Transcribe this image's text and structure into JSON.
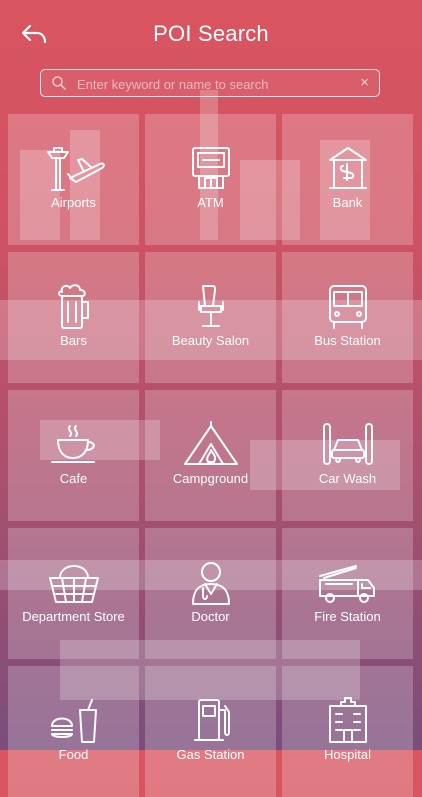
{
  "header": {
    "title": "POI Search"
  },
  "search": {
    "placeholder": "Enter keyword or name to search",
    "clear_glyph": "×"
  },
  "categories": [
    {
      "label": "Airports",
      "icon": "airport-icon"
    },
    {
      "label": "ATM",
      "icon": "atm-icon"
    },
    {
      "label": "Bank",
      "icon": "bank-icon"
    },
    {
      "label": "Bars",
      "icon": "beer-icon"
    },
    {
      "label": "Beauty Salon",
      "icon": "salon-chair-icon"
    },
    {
      "label": "Bus Station",
      "icon": "bus-icon"
    },
    {
      "label": "Cafe",
      "icon": "coffee-cup-icon"
    },
    {
      "label": "Campground",
      "icon": "tent-icon"
    },
    {
      "label": "Car Wash",
      "icon": "car-wash-icon"
    },
    {
      "label": "Department Store",
      "icon": "basket-icon"
    },
    {
      "label": "Doctor",
      "icon": "doctor-icon"
    },
    {
      "label": "Fire Station",
      "icon": "fire-truck-icon"
    },
    {
      "label": "Food",
      "icon": "food-icon"
    },
    {
      "label": "Gas Station",
      "icon": "gas-pump-icon"
    },
    {
      "label": "Hospital",
      "icon": "hospital-icon"
    }
  ],
  "colors": {
    "gradient_top": "#d95560",
    "gradient_bottom": "#7a4d7c",
    "tile": "rgba(255,255,255,0.22)"
  }
}
